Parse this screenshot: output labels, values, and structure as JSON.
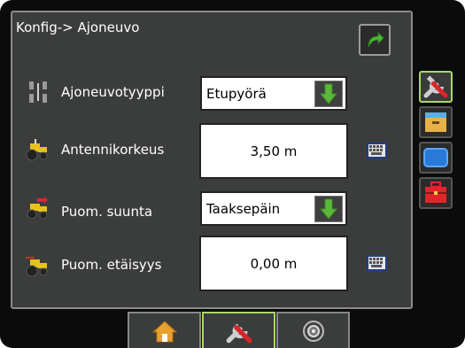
{
  "header": {
    "title": "Konfig-> Ajoneuvo"
  },
  "rows": [
    {
      "label": "Ajoneuvotyyppi",
      "value": "Etupyörä",
      "icon": "vehicle-axle-icon",
      "control": "dropdown"
    },
    {
      "label": "Antennikorkeus",
      "value": "3,50 m",
      "icon": "tractor-antenna-icon",
      "control": "keyboard"
    },
    {
      "label": "Puom. suunta",
      "value": "Taaksepäin",
      "icon": "tractor-boom-direction-icon",
      "control": "dropdown"
    },
    {
      "label": "Puom. etäisyys",
      "value": "0,00 m",
      "icon": "tractor-boom-distance-icon",
      "control": "keyboard"
    }
  ],
  "sidebar": [
    "tools-icon",
    "console-icon",
    "display-icon",
    "toolbox-icon"
  ],
  "tabs": [
    "home-icon",
    "tools-icon",
    "gps-icon"
  ],
  "colors": {
    "panel": "#3b3d3c",
    "accent": "#a8d86a",
    "arrow": "#5bb83a"
  }
}
